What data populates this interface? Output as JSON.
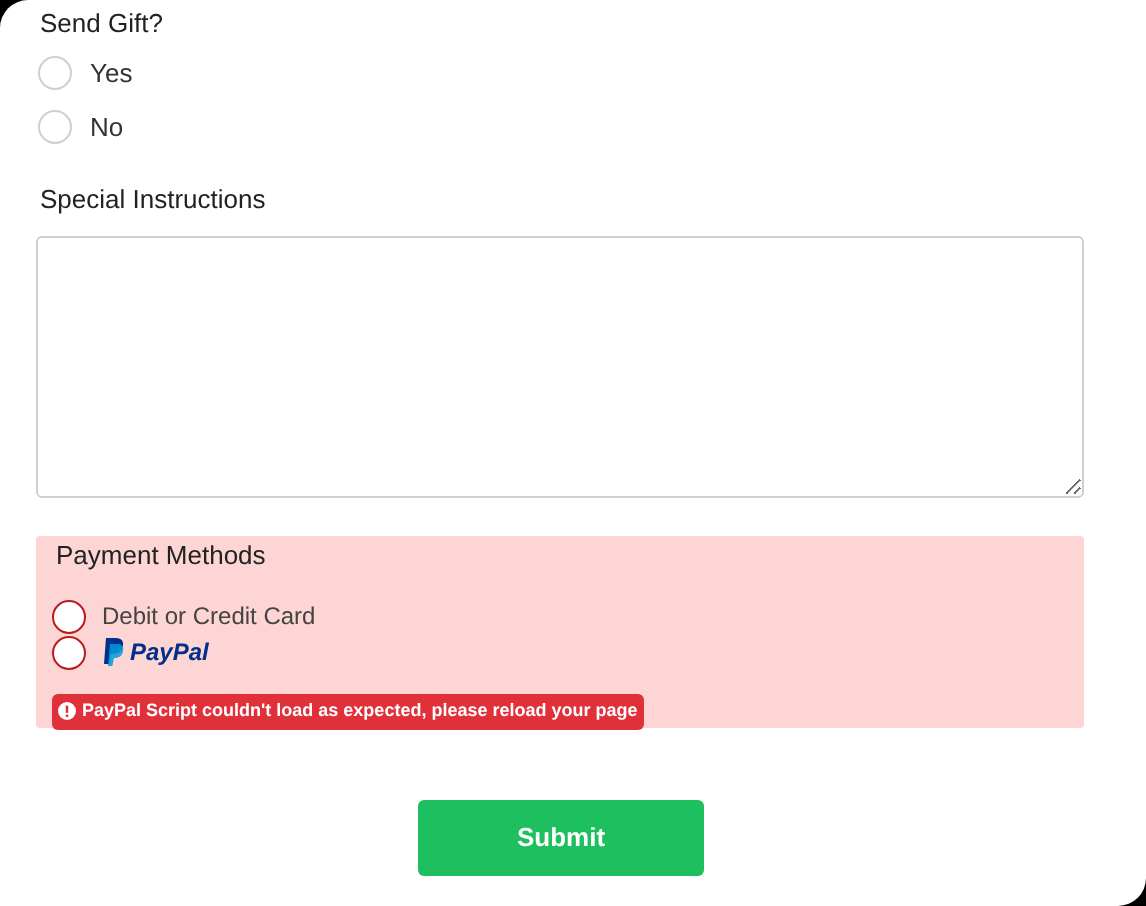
{
  "send_gift": {
    "label": "Send Gift?",
    "options": [
      {
        "label": "Yes",
        "selected": false
      },
      {
        "label": "No",
        "selected": false
      }
    ]
  },
  "special_instructions": {
    "label": "Special Instructions"
  },
  "payment_methods": {
    "label": "Payment Methods",
    "error": true,
    "options": [
      {
        "kind": "text",
        "label": "Debit or Credit Card",
        "selected": false
      },
      {
        "kind": "paypal",
        "label": "PayPal",
        "selected": false
      }
    ],
    "error_message": "PayPal Script couldn't load as expected, please reload your page"
  },
  "submit": {
    "label": "Submit"
  }
}
